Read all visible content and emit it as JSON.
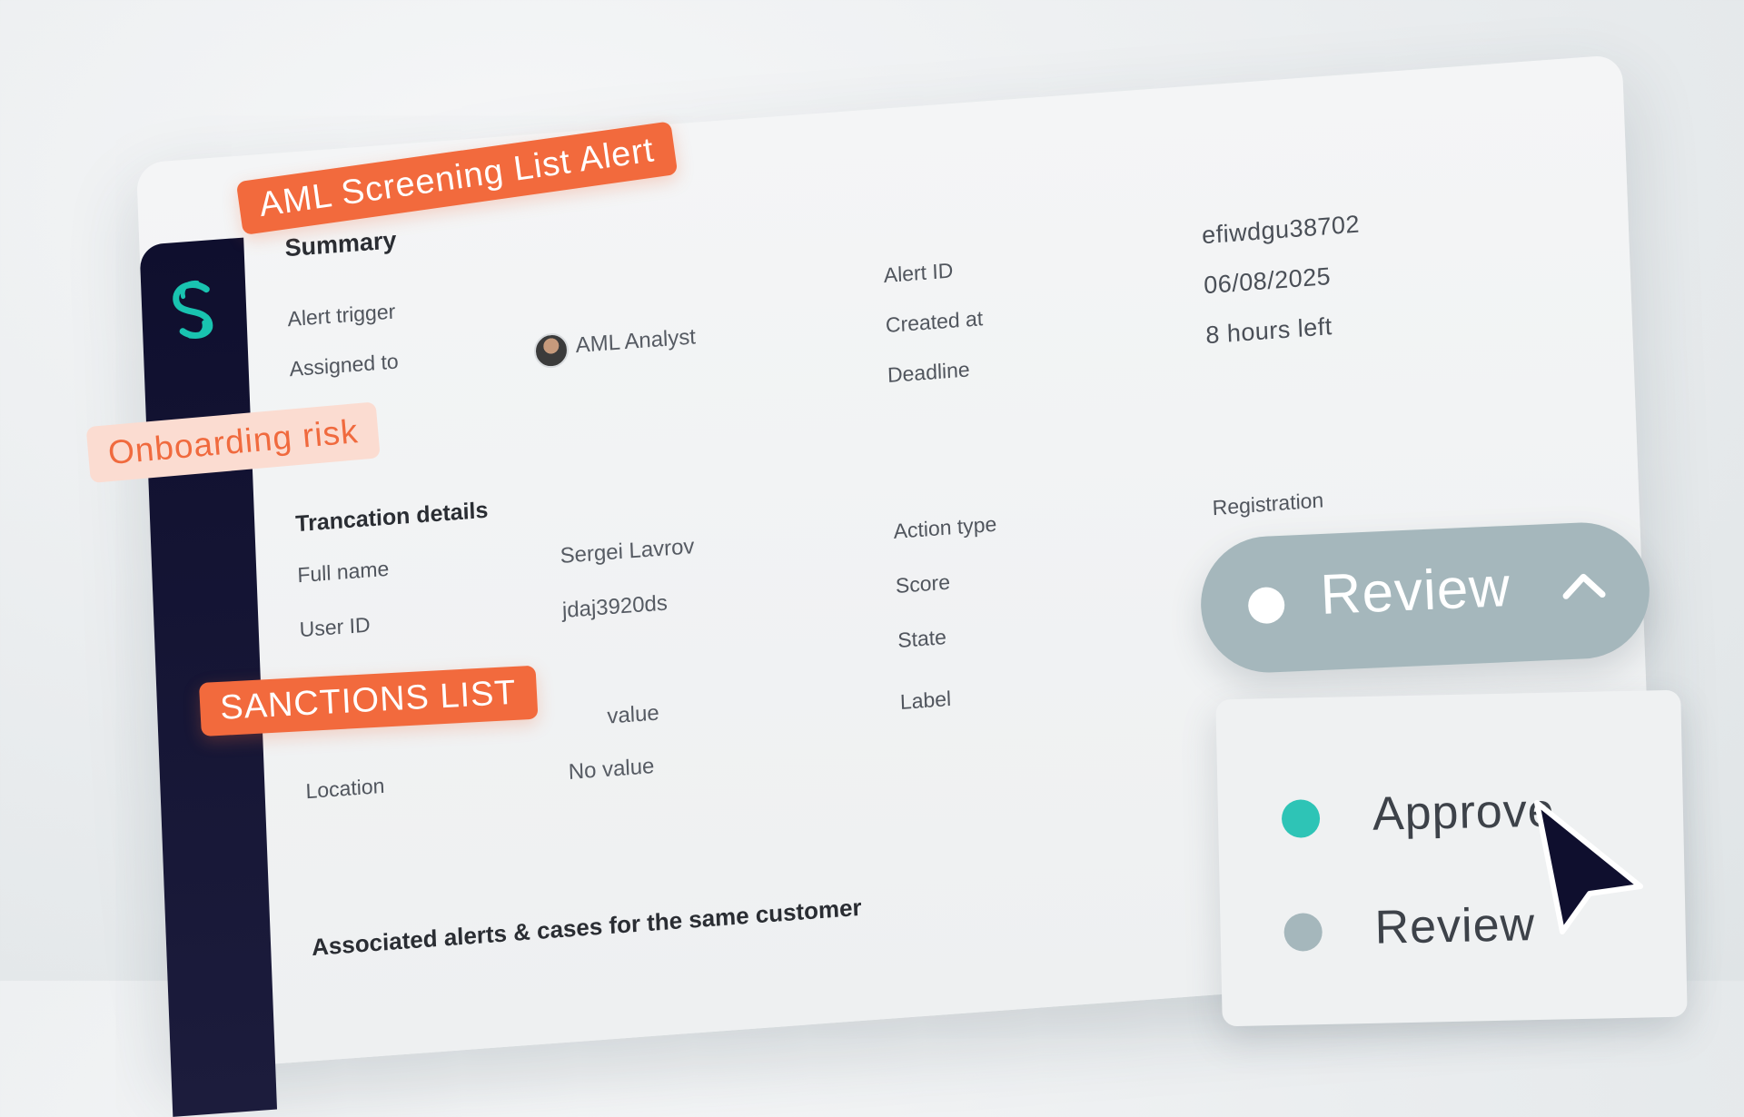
{
  "tags": {
    "alert_title": "AML Screening List Alert",
    "onboarding": "Onboarding risk",
    "sanctions": "SANCTIONS LIST"
  },
  "summary": {
    "title": "Summary",
    "alert_trigger_label": "Alert trigger",
    "assigned_to_label": "Assigned to",
    "assignee": "AML Analyst",
    "alert_id_label": "Alert ID",
    "alert_id_value": "efiwdgu38702",
    "created_at_label": "Created at",
    "created_at_value": "06/08/2025",
    "deadline_label": "Deadline",
    "deadline_value": "8 hours left"
  },
  "transaction": {
    "title": "Trancation details",
    "full_name_label": "Full name",
    "full_name_value": "Sergei Lavrov",
    "user_id_label": "User ID",
    "user_id_value": "jdaj3920ds",
    "hidden_value": "value",
    "location_label": "Location",
    "location_value": "No value",
    "action_type_label": "Action type",
    "score_label": "Score",
    "state_label": "State",
    "label_label": "Label",
    "registration_label": "Registration"
  },
  "status": {
    "current": "Review",
    "options": [
      {
        "label": "Approve",
        "color": "#2ec4b6"
      },
      {
        "label": "Review",
        "color": "#a5b7bc"
      }
    ]
  },
  "footer": {
    "associated": "Associated alerts & cases for the same customer"
  },
  "colors": {
    "accent_orange": "#f26a3d",
    "sidebar_navy": "#0f0f2e",
    "logo_teal": "#19c3b0"
  }
}
